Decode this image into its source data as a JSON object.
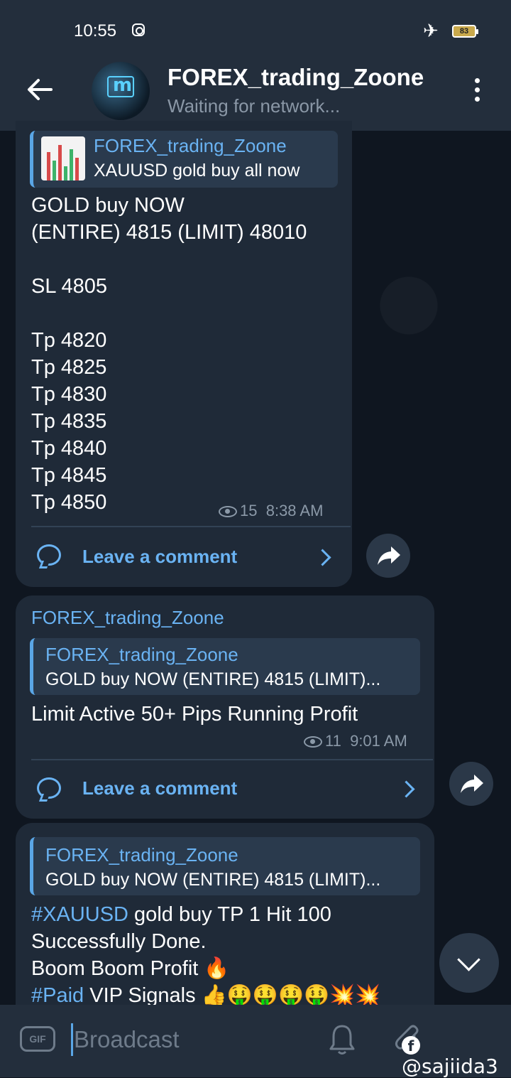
{
  "status_bar": {
    "time": "10:55",
    "battery": "83"
  },
  "header": {
    "title": "FOREX_trading_Zoone",
    "subtitle": "Waiting for network..."
  },
  "messages": [
    {
      "reply_name": "FOREX_trading_Zoone",
      "reply_text": "XAUUSD gold buy all now",
      "text": "GOLD buy NOW\n(ENTIRE) 4815 (LIMIT) 48010\n\nSL 4805\n\nTp 4820\nTp 4825\nTp 4830\nTp 4835\nTp 4840\nTp 4845\nTp 4850",
      "views": "15",
      "time": "8:38 AM",
      "comment_label": "Leave a comment"
    },
    {
      "sender": "FOREX_trading_Zoone",
      "reply_name": "FOREX_trading_Zoone",
      "reply_text": "GOLD buy NOW  (ENTIRE) 4815 (LIMIT)...",
      "text": "Limit Active 50+ Pips Running Profit",
      "views": "11",
      "time": "9:01 AM",
      "comment_label": "Leave a comment"
    },
    {
      "reply_name": "FOREX_trading_Zoone",
      "reply_text": "GOLD buy NOW  (ENTIRE) 4815 (LIMIT)...",
      "hashtag1": "#XAUUSD",
      "line1_rest": " gold buy TP 1 Hit 100",
      "line2": "Successfully Done.",
      "line3": "Boom Boom Profit 🔥",
      "hashtag2": "#Paid",
      "line4_rest": " VIP Signals 👍🤑🤑🤑🤑💥💥"
    }
  ],
  "input": {
    "placeholder": "Broadcast",
    "gif_label": "GIF"
  },
  "watermark": "@sajiida3"
}
